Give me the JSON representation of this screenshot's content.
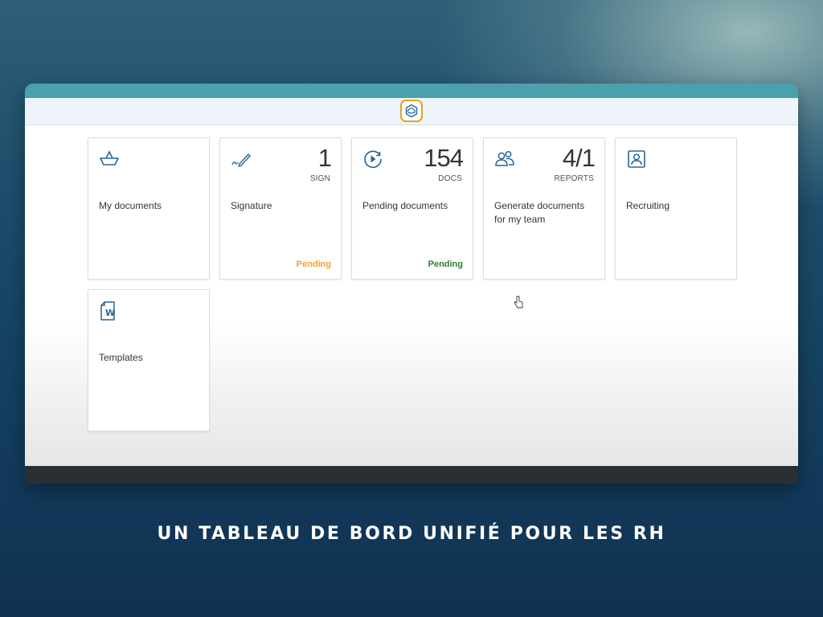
{
  "colors": {
    "accent_teal": "#4aa0ad",
    "logo_border": "#e8a317",
    "icon_blue": "#2a6496",
    "status_warning": "#e9a23b",
    "status_success": "#2b7d2b"
  },
  "header": {
    "logo_icon": "cloud-hexagon-icon"
  },
  "tiles": [
    {
      "title": "My documents",
      "icon": "basket-icon"
    },
    {
      "title": "Signature",
      "icon": "pen-signature-icon",
      "number": "1",
      "unit": "SIGN",
      "status": "Pending"
    },
    {
      "title": "Pending documents",
      "icon": "play-circle-icon",
      "number": "154",
      "unit": "DOCS",
      "status": "Pending"
    },
    {
      "title": "Generate documents for my team",
      "icon": "group-icon",
      "number": "4/1",
      "unit": "REPORTS"
    },
    {
      "title": "Recruiting",
      "icon": "person-card-icon"
    },
    {
      "title": "Templates",
      "icon": "word-document-icon"
    }
  ],
  "caption": "UN TABLEAU DE BORD UNIFIÉ POUR LES RH"
}
